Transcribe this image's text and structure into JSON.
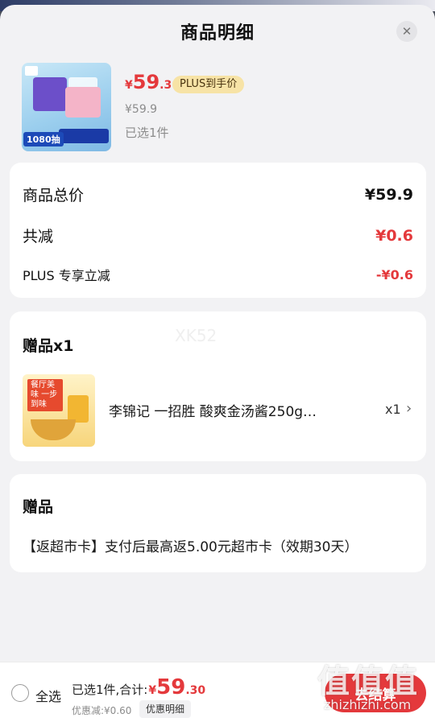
{
  "header": {
    "title": "商品明细",
    "close_symbol": "✕"
  },
  "product": {
    "price_currency": "¥",
    "price_int": "59",
    "price_dec": ".3",
    "plus_label": "PLUS到手价",
    "original_price": "¥59.9",
    "selected_text": "已选1件",
    "thumb_tag": "1080抽"
  },
  "summary": {
    "total_label": "商品总价",
    "total_value": "¥59.9",
    "reduce_label": "共减",
    "reduce_value": "¥0.6",
    "plus_label": "PLUS 专享立减",
    "plus_value": "-¥0.6"
  },
  "gift": {
    "title": "赠品x1",
    "watermark": "XK52",
    "item_name": "李锦记 一招胜 酸爽金汤酱250g…",
    "item_qty": "x1",
    "thumb_text": "餐厅美味 一步到味"
  },
  "coupon": {
    "title": "赠品",
    "description": "【返超市卡】支付后最高返5.00元超市卡（效期30天）"
  },
  "bottom_bar": {
    "select_all": "全选",
    "total_prefix": "已选1件,合计:",
    "total_currency": "¥",
    "total_int": "59",
    "total_dec": ".30",
    "discount_text": "优惠减:¥0.60",
    "discount_detail": "优惠明细",
    "checkout": "去结算"
  },
  "watermark": {
    "logo": "值值值",
    "url": "zhizhizhi.com"
  },
  "colors": {
    "accent": "#e4393c",
    "plus_gold": "#f7e3a6"
  }
}
